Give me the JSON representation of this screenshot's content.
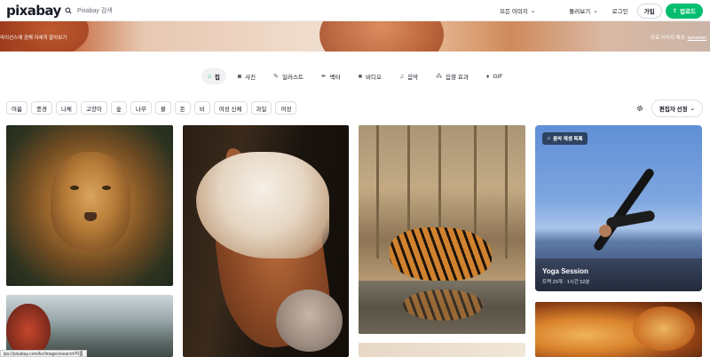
{
  "header": {
    "logo": "pixabay",
    "search_placeholder": "Pixabay 검색",
    "images_label": "모든 이미지",
    "explore_label": "둘러보기",
    "login_label": "로그인",
    "join_label": "가입",
    "upload_label": "업로드"
  },
  "hero": {
    "left_text": "라이선스에 관해 자세히 알아보기",
    "right_prefix": "무료 이미지 제공:",
    "right_author": "lamarton"
  },
  "categories": [
    {
      "label": "집",
      "icon": "home-icon"
    },
    {
      "label": "사진",
      "icon": "camera-icon"
    },
    {
      "label": "일러스트",
      "icon": "brush-icon"
    },
    {
      "label": "벡터",
      "icon": "pen-icon"
    },
    {
      "label": "비디오",
      "icon": "video-icon"
    },
    {
      "label": "음악",
      "icon": "music-icon"
    },
    {
      "label": "음향 효과",
      "icon": "sound-effect-icon"
    },
    {
      "label": "GIF",
      "icon": "gif-icon"
    }
  ],
  "tags": [
    "여름",
    "풍경",
    "나체",
    "고양이",
    "숲",
    "나무",
    "물",
    "돈",
    "비",
    "여성 신체",
    "과일",
    "여성"
  ],
  "sort_label": "편집자 선정",
  "yoga_card": {
    "badge": "음악 재생 목록",
    "title": "Yoga Session",
    "meta": "트랙 20개 · 1시간 52분"
  },
  "status_url": "tps://pixabay.com/ko/images/search/여름"
}
